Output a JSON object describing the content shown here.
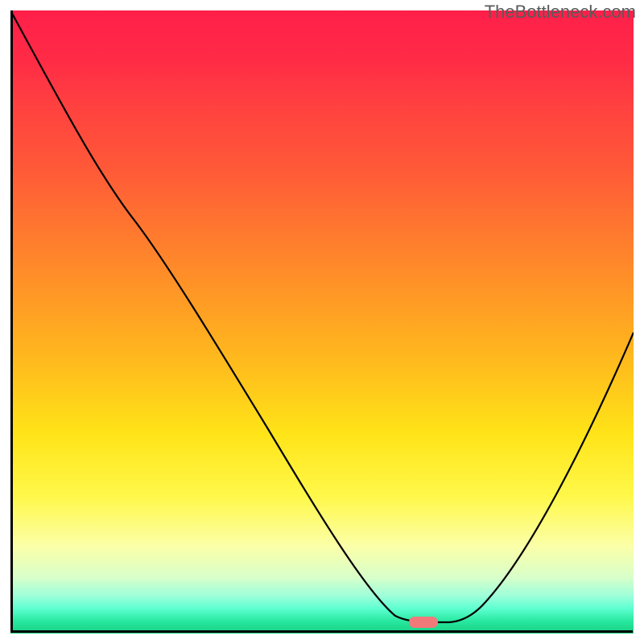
{
  "watermark": "TheBottleneck.com",
  "colors": {
    "gradient_top": "#ff1f4a",
    "gradient_mid_upper": "#ff7a2e",
    "gradient_mid": "#ffe418",
    "gradient_lower": "#9cffda",
    "gradient_bottom": "#16d082",
    "curve_stroke": "#000000",
    "marker_fill": "#f27979",
    "axis_stroke": "#000000"
  },
  "chart_data": {
    "type": "line",
    "title": "",
    "xlabel": "",
    "ylabel": "",
    "xlim": [
      0,
      100
    ],
    "ylim": [
      0,
      100
    ],
    "grid": false,
    "legend": false,
    "series": [
      {
        "name": "bottleneck_curve",
        "x": [
          0,
          8,
          15,
          20,
          28,
          35,
          42,
          50,
          57,
          62,
          65,
          67,
          70,
          74,
          80,
          88,
          100
        ],
        "y": [
          100,
          86,
          73,
          66,
          55,
          45,
          33,
          20,
          10,
          4,
          2,
          2,
          2,
          5,
          15,
          32,
          48
        ]
      }
    ],
    "marker": {
      "name": "optimal_point",
      "x_range": [
        64,
        70
      ],
      "y": 2,
      "color": "#f27979"
    },
    "background": {
      "type": "vertical_gradient",
      "description": "red (high bottleneck) at top through orange/yellow to green (low bottleneck) at bottom",
      "stops": [
        {
          "pos": 0.0,
          "color": "#ff1f4a"
        },
        {
          "pos": 0.25,
          "color": "#ff5838"
        },
        {
          "pos": 0.5,
          "color": "#ffc01c"
        },
        {
          "pos": 0.78,
          "color": "#fff84a"
        },
        {
          "pos": 0.94,
          "color": "#9cffda"
        },
        {
          "pos": 1.0,
          "color": "#16d082"
        }
      ]
    }
  }
}
